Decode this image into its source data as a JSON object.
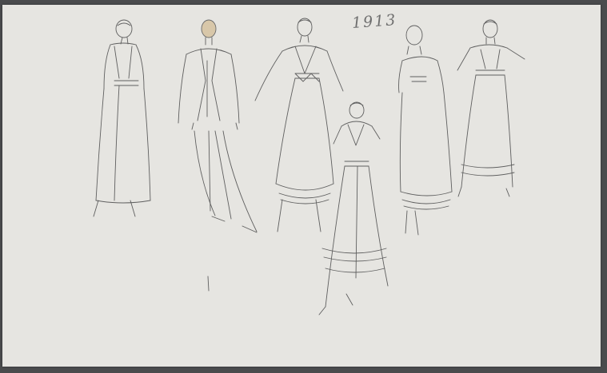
{
  "artwork": {
    "annotation": "1913",
    "figures": [
      "figure-1",
      "figure-2",
      "figure-3",
      "figure-4",
      "figure-5",
      "figure-6"
    ]
  },
  "colors": {
    "paper": "#e6e5e1",
    "background": "#4a4b4d",
    "pencil": "#5a5a5a"
  }
}
